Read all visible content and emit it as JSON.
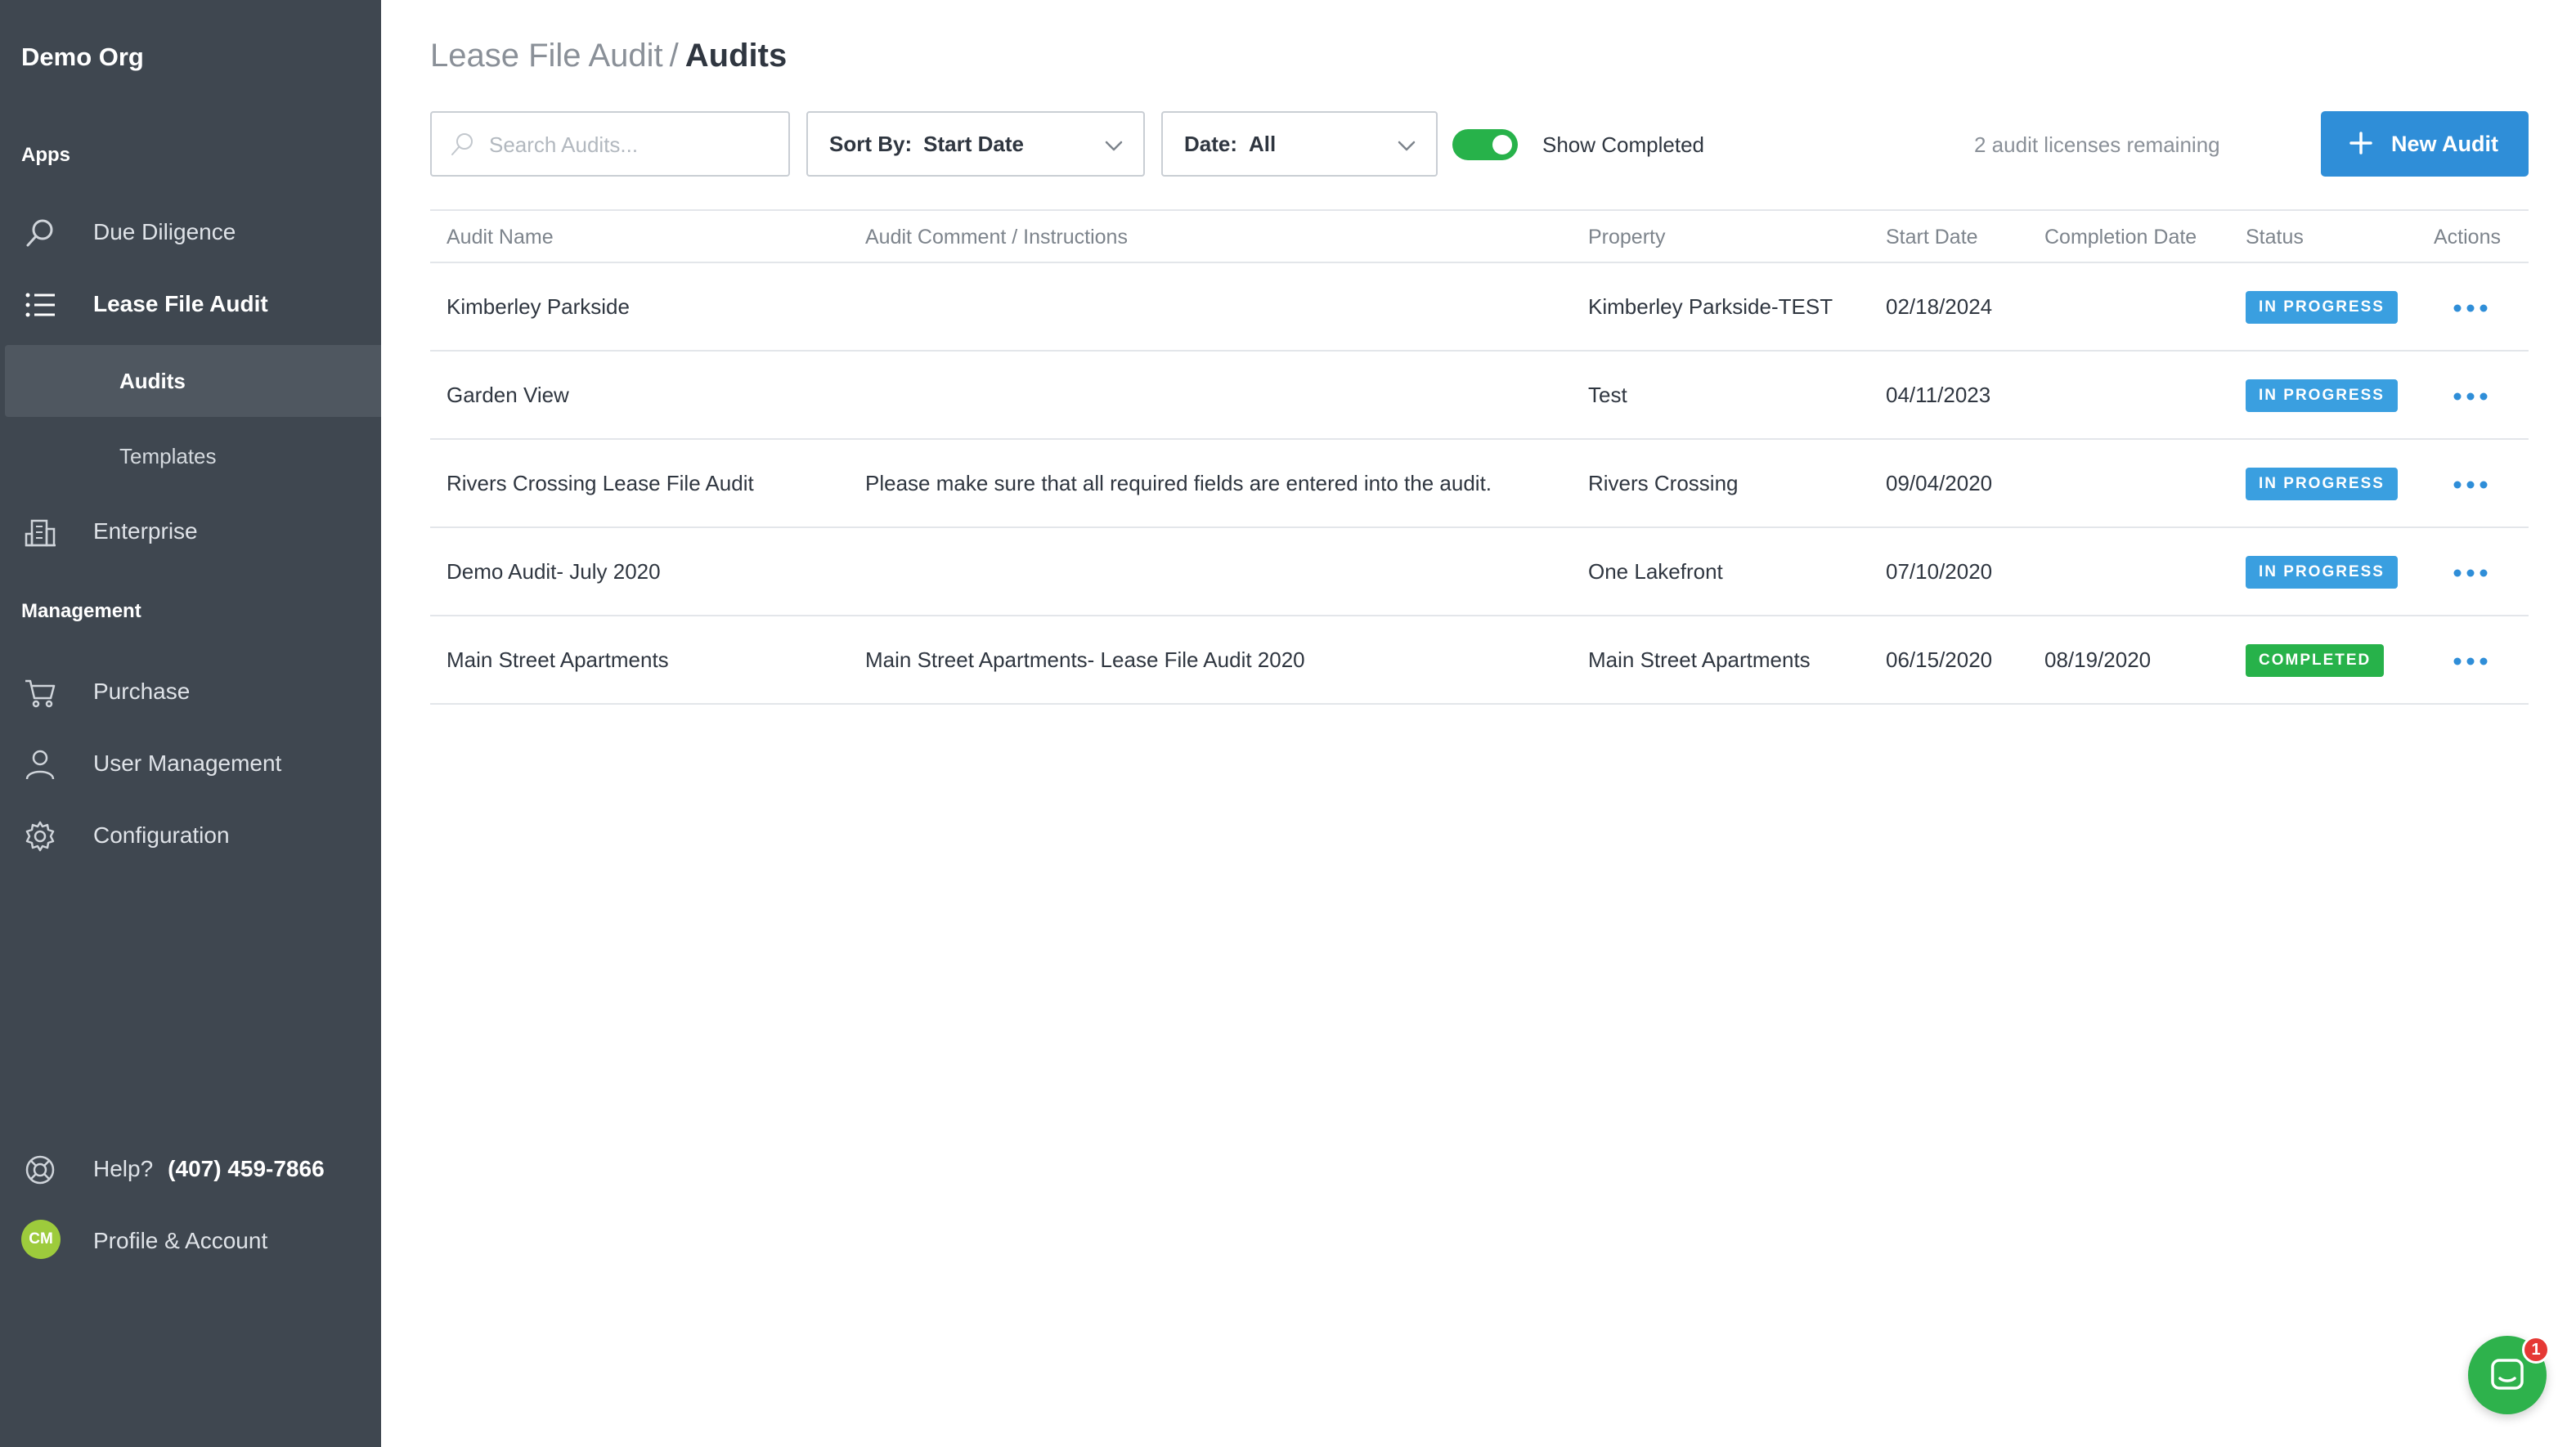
{
  "sidebar": {
    "org_name": "Demo Org",
    "apps_label": "Apps",
    "management_label": "Management",
    "items": {
      "due_diligence": "Due Diligence",
      "lease_file_audit": "Lease File Audit",
      "audits": "Audits",
      "templates": "Templates",
      "enterprise": "Enterprise",
      "purchase": "Purchase",
      "user_management": "User Management",
      "configuration": "Configuration"
    },
    "help_label": "Help?",
    "help_phone": "(407) 459-7866",
    "avatar_initials": "CM",
    "profile_label": "Profile & Account"
  },
  "header": {
    "breadcrumb_parent": "Lease File Audit",
    "breadcrumb_sep": "/",
    "breadcrumb_current": "Audits"
  },
  "toolbar": {
    "search_placeholder": "Search Audits...",
    "sort_label": "Sort By:",
    "sort_value": "Start Date",
    "date_label": "Date:",
    "date_value": "All",
    "show_completed_label": "Show Completed",
    "show_completed_on": true,
    "licenses_text": "2 audit licenses remaining",
    "new_audit_label": "New Audit"
  },
  "table": {
    "columns": {
      "name": "Audit Name",
      "comment": "Audit Comment / Instructions",
      "property": "Property",
      "start": "Start Date",
      "completion": "Completion Date",
      "status": "Status",
      "actions": "Actions"
    },
    "rows": [
      {
        "name": "Kimberley Parkside",
        "comment": "",
        "property": "Kimberley Parkside-TEST",
        "start": "02/18/2024",
        "completion": "",
        "status": "IN PROGRESS"
      },
      {
        "name": "Garden View",
        "comment": "",
        "property": "Test",
        "start": "04/11/2023",
        "completion": "",
        "status": "IN PROGRESS"
      },
      {
        "name": "Rivers Crossing Lease File Audit",
        "comment": "Please make sure that all required fields are entered into the audit.",
        "property": "Rivers Crossing",
        "start": "09/04/2020",
        "completion": "",
        "status": "IN PROGRESS"
      },
      {
        "name": "Demo Audit- July 2020",
        "comment": "",
        "property": "One Lakefront",
        "start": "07/10/2020",
        "completion": "",
        "status": "IN PROGRESS"
      },
      {
        "name": "Main Street Apartments",
        "comment": "Main Street Apartments- Lease File Audit 2020",
        "property": "Main Street Apartments",
        "start": "06/15/2020",
        "completion": "08/19/2020",
        "status": "COMPLETED"
      }
    ]
  },
  "chat": {
    "unread_count": "1"
  },
  "colors": {
    "sidebar_bg": "#3f4750",
    "accent_blue": "#2f8ed8",
    "in_progress": "#3a9fe0",
    "completed": "#27b24a",
    "chat_green": "#2eb24c",
    "notification_red": "#e53935"
  },
  "icons": {
    "due_diligence": "search-icon",
    "lease_file_audit": "list-icon",
    "enterprise": "building-icon",
    "purchase": "cart-icon",
    "user_management": "user-icon",
    "configuration": "gear-icon",
    "help": "lifebuoy-icon",
    "chat": "chat-icon"
  }
}
